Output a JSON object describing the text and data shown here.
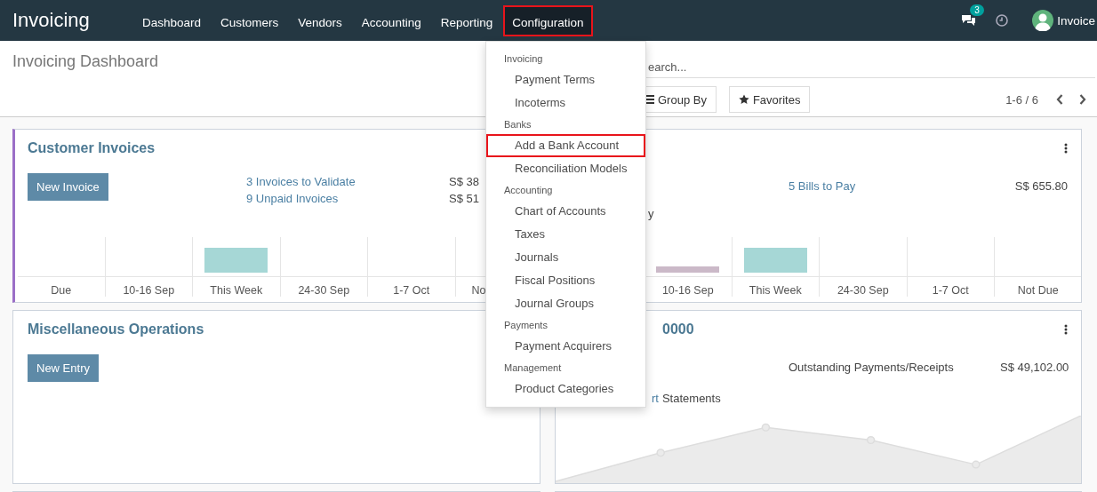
{
  "navbar": {
    "brand": "Invoicing",
    "menu": [
      {
        "label": "Dashboard",
        "open": false,
        "highlighted": false
      },
      {
        "label": "Customers",
        "open": false,
        "highlighted": false
      },
      {
        "label": "Vendors",
        "open": false,
        "highlighted": false
      },
      {
        "label": "Accounting",
        "open": false,
        "highlighted": false
      },
      {
        "label": "Reporting",
        "open": false,
        "highlighted": false
      },
      {
        "label": "Configuration",
        "open": true,
        "highlighted": true
      }
    ],
    "messages_badge": "3",
    "user": "Invoice"
  },
  "control_panel": {
    "title": "Invoicing Dashboard",
    "search": {
      "placeholder": "earch..."
    },
    "buttons": [
      "Group By",
      "Favorites"
    ],
    "pager": "1-6 / 6"
  },
  "dropdown": [
    {
      "kind": "header",
      "label": "Invoicing"
    },
    {
      "kind": "item",
      "label": "Payment Terms",
      "highlighted": false
    },
    {
      "kind": "item",
      "label": "Incoterms",
      "highlighted": false
    },
    {
      "kind": "header",
      "label": "Banks"
    },
    {
      "kind": "item",
      "label": "Add a Bank Account",
      "highlighted": true
    },
    {
      "kind": "item",
      "label": "Reconciliation Models",
      "highlighted": false
    },
    {
      "kind": "header",
      "label": "Accounting"
    },
    {
      "kind": "item",
      "label": "Chart of Accounts",
      "highlighted": false
    },
    {
      "kind": "item",
      "label": "Taxes",
      "highlighted": false
    },
    {
      "kind": "item",
      "label": "Journals",
      "highlighted": false
    },
    {
      "kind": "item",
      "label": "Fiscal Positions",
      "highlighted": false
    },
    {
      "kind": "item",
      "label": "Journal Groups",
      "highlighted": false
    },
    {
      "kind": "header",
      "label": "Payments"
    },
    {
      "kind": "item",
      "label": "Payment Acquirers",
      "highlighted": false
    },
    {
      "kind": "header",
      "label": "Management"
    },
    {
      "kind": "item",
      "label": "Product Categories",
      "highlighted": false
    }
  ],
  "cards": [
    {
      "kind": "bars",
      "title": "Customer Invoices",
      "color": "#9b6fc7",
      "button": "New Invoice",
      "stats": [
        {
          "label": "3 Invoices to Validate",
          "amount": "S$ 38"
        },
        {
          "label": "9 Unpaid Invoices",
          "amount": "S$ 51"
        }
      ],
      "columns": [
        {
          "label": "Due",
          "kind": "empty"
        },
        {
          "label": "10-16 Sep",
          "kind": "empty"
        },
        {
          "label": "This Week",
          "kind": "current"
        },
        {
          "label": "24-30 Sep",
          "kind": "empty"
        },
        {
          "label": "1-7 Oct",
          "kind": "empty"
        },
        {
          "label": "No",
          "kind": "empty"
        }
      ]
    },
    {
      "kind": "bars",
      "menu_icon": true,
      "stats": [
        {
          "label": "5 Bills to Pay",
          "amount": "S$ 655.80"
        }
      ],
      "note": "y",
      "columns": [
        {
          "label": "10-16 Sep",
          "kind": "past"
        },
        {
          "label": "This Week",
          "kind": "current"
        },
        {
          "label": "24-30 Sep",
          "kind": "empty"
        },
        {
          "label": "1-7 Oct",
          "kind": "empty"
        },
        {
          "label": "Not Due",
          "kind": "empty"
        }
      ]
    },
    {
      "kind": "plain",
      "title": "Miscellaneous Operations",
      "button": "New Entry"
    },
    {
      "kind": "line",
      "title": "0000",
      "menu_icon": true,
      "stats": [
        {
          "label": "Outstanding Payments/Receipts",
          "amount": "S$ 49,102.00",
          "plain": true
        }
      ],
      "note_link": "rt",
      "note": "Statements"
    },
    {
      "kind": "plain"
    },
    {
      "kind": "plain"
    }
  ]
}
